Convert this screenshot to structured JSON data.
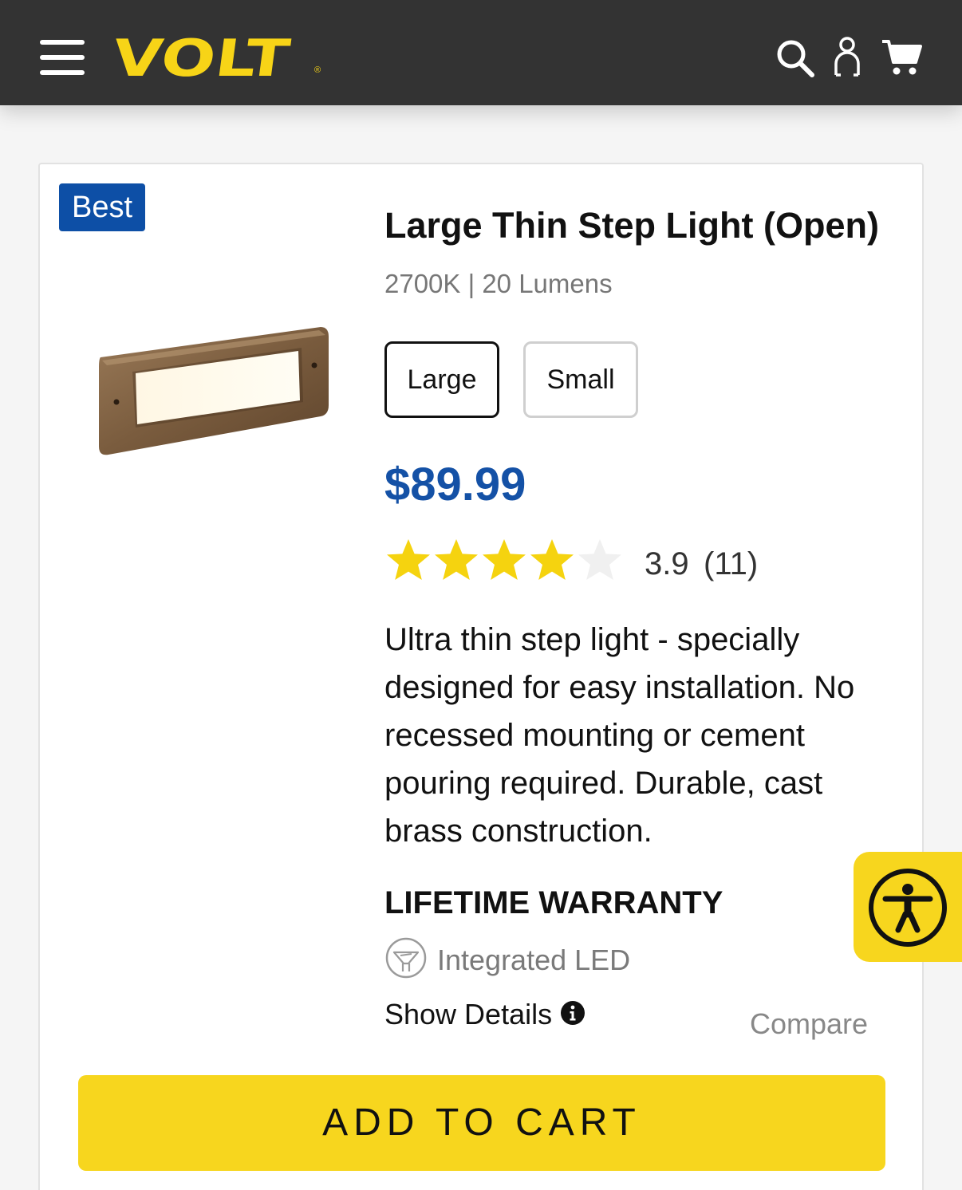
{
  "header": {
    "logo_text": "VOLT",
    "logo_reg": "®",
    "icons": [
      "menu-icon",
      "search-icon",
      "account-icon",
      "cart-icon"
    ]
  },
  "product": {
    "badge": "Best",
    "title": "Large Thin Step Light (Open)",
    "subtitle": "2700K | 20 Lumens",
    "variants": [
      {
        "label": "Large",
        "selected": true
      },
      {
        "label": "Small",
        "selected": false
      }
    ],
    "price": "$89.99",
    "rating": {
      "value": "3.9",
      "count": "(11)",
      "stars": 3.9,
      "max": 5
    },
    "description": "Ultra thin step light - specially designed for easy installation. No recessed mounting or cement pouring required. Durable, cast brass construction.",
    "warranty": "LIFETIME WARRANTY",
    "feature": "Integrated LED",
    "show_details": "Show Details",
    "compare": "Compare",
    "add_to_cart": "ADD TO CART"
  },
  "colors": {
    "header_bg": "#333333",
    "brand_yellow": "#f7d417",
    "price_blue": "#1451a6",
    "badge_blue": "#0d4fa6",
    "star_gold": "#f5d30f"
  }
}
